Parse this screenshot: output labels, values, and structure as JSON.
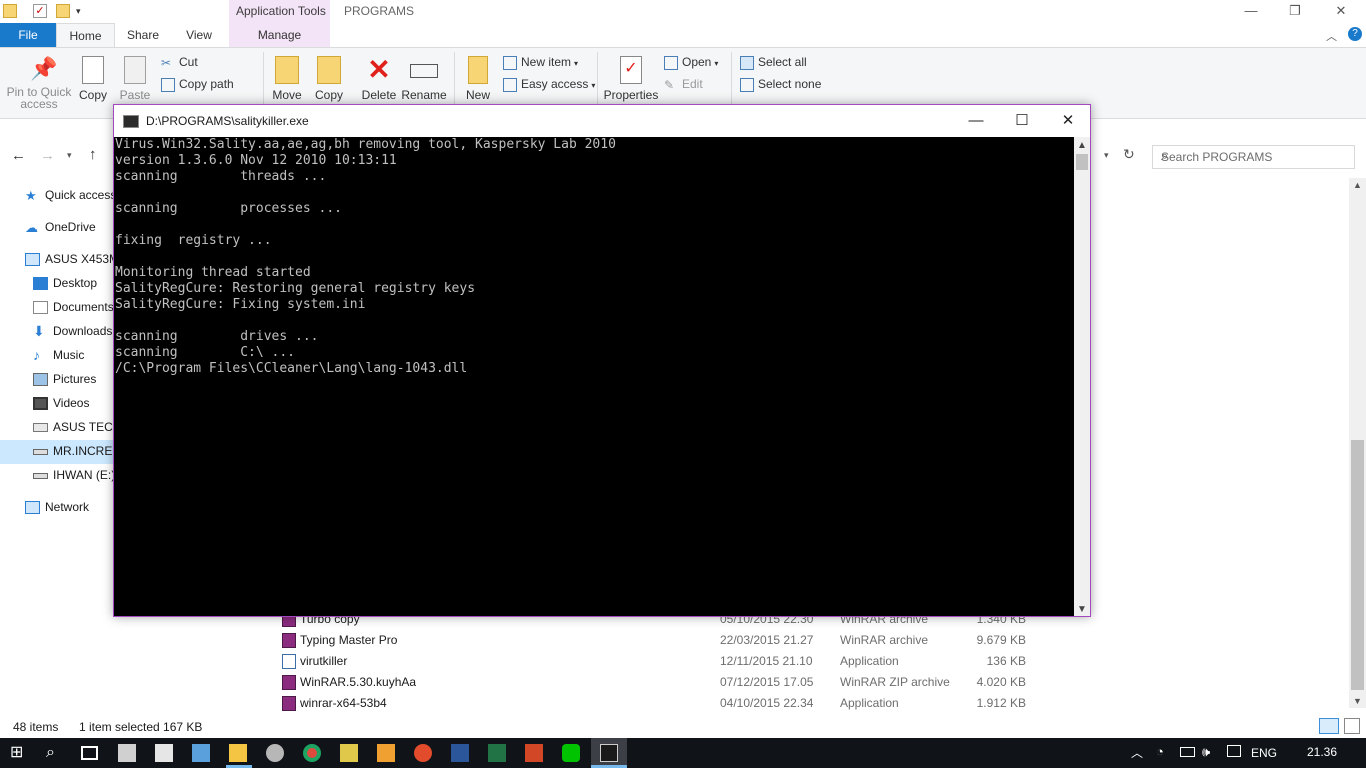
{
  "explorer": {
    "titlebar": {
      "contextual_tab": "Application Tools",
      "folder": "PROGRAMS"
    },
    "tabs": [
      "File",
      "Home",
      "Share",
      "View",
      "Manage"
    ],
    "ribbon": {
      "pin": "Pin to Quick access",
      "copy": "Copy",
      "paste": "Paste",
      "cut": "Cut",
      "copy_path": "Copy path",
      "move": "Move",
      "copy_to": "Copy",
      "delete": "Delete",
      "rename": "Rename",
      "new": "New",
      "new_item": "New item",
      "easy_access": "Easy access",
      "properties": "Properties",
      "open": "Open",
      "edit": "Edit",
      "select_all": "Select all",
      "select_none": "Select none"
    },
    "search_placeholder": "Search PROGRAMS",
    "nav": {
      "quick_access": "Quick access",
      "onedrive": "OneDrive",
      "pc": "ASUS X453M",
      "desktop": "Desktop",
      "documents": "Documents",
      "downloads": "Downloads",
      "music": "Music",
      "pictures": "Pictures",
      "videos": "Videos",
      "drive1": "ASUS TECH",
      "drive2": "MR.INCRED",
      "drive3": "IHWAN (E:)",
      "network": "Network"
    },
    "files": [
      {
        "name": "Turbo copy",
        "date": "05/10/2015 22.30",
        "type": "WinRAR archive",
        "size": "1.340 KB"
      },
      {
        "name": "Typing Master Pro",
        "date": "22/03/2015 21.27",
        "type": "WinRAR archive",
        "size": "9.679 KB"
      },
      {
        "name": "virutkiller",
        "date": "12/11/2015 21.10",
        "type": "Application",
        "size": "136 KB"
      },
      {
        "name": "WinRAR.5.30.kuyhAa",
        "date": "07/12/2015 17.05",
        "type": "WinRAR ZIP archive",
        "size": "4.020 KB"
      },
      {
        "name": "winrar-x64-53b4",
        "date": "04/10/2015 22.34",
        "type": "Application",
        "size": "1.912 KB"
      }
    ],
    "status": {
      "items": "48 items",
      "selected": "1 item selected  167 KB"
    }
  },
  "console": {
    "title": "D:\\PROGRAMS\\salitykiller.exe",
    "output": "Virus.Win32.Sality.aa,ae,ag,bh removing tool, Kaspersky Lab 2010\nversion 1.3.6.0 Nov 12 2010 10:13:11\nscanning        threads ...\n\nscanning        processes ...\n\nfixing  registry ...\n\nMonitoring thread started\nSalityRegCure: Restoring general registry keys\nSalityRegCure: Fixing system.ini\n\nscanning        drives ...\nscanning        C:\\ ...\n/C:\\Program Files\\CCleaner\\Lang\\lang-1043.dll"
  },
  "taskbar": {
    "language": "ENG",
    "clock": "21.36"
  },
  "colors": {
    "accent": "#1979ca",
    "console_border": "#a348c1",
    "manage_tab": "#f3e4f7"
  }
}
